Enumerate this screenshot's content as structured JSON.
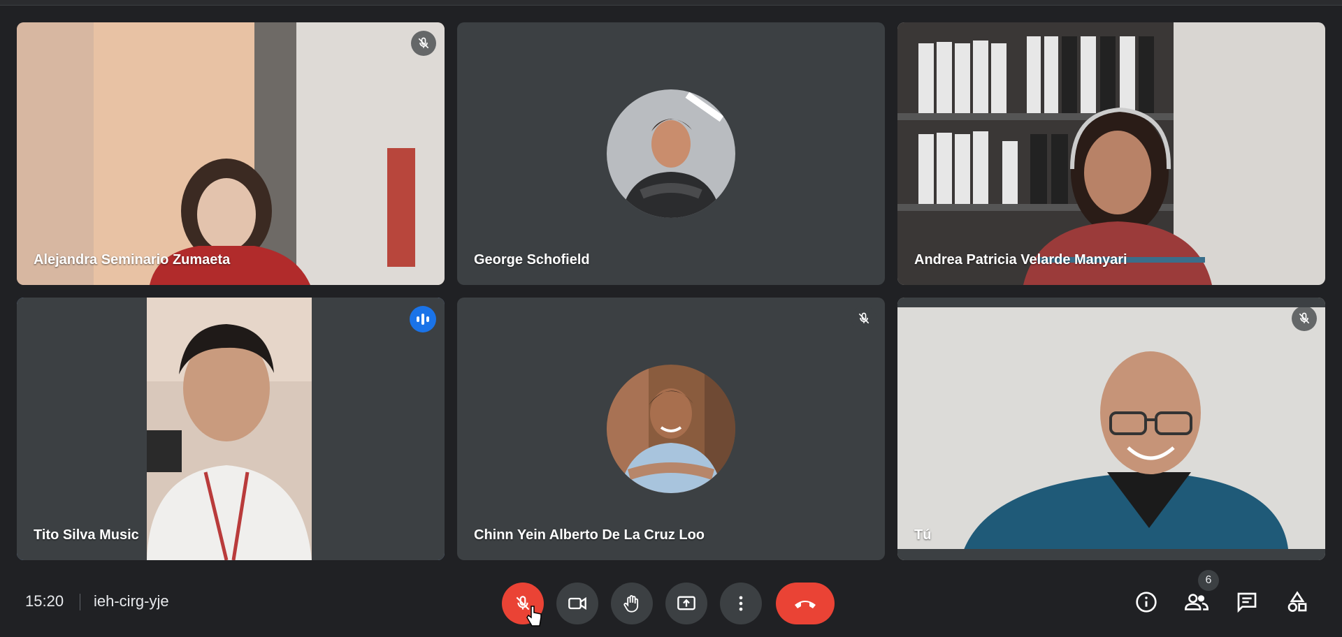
{
  "participants": [
    {
      "name": "Alejandra Seminario Zumaeta",
      "muted": true
    },
    {
      "name": "George Schofield",
      "muted": false
    },
    {
      "name": "Andrea Patricia Velarde Manyari",
      "muted": false
    },
    {
      "name": "Tito Silva Music",
      "speaking": true
    },
    {
      "name": "Chinn Yein Alberto De La Cruz Loo",
      "muted": true
    },
    {
      "name": "Tú",
      "muted": true
    }
  ],
  "meeting": {
    "time": "15:20",
    "code": "ieh-cirg-yje"
  },
  "controls": [
    "mic-off-icon",
    "camera-icon",
    "raise-hand-icon",
    "present-screen-icon",
    "more-options-icon",
    "end-call-icon"
  ],
  "side": {
    "people_count": "6"
  },
  "colors": {
    "accent": "#1a73e8",
    "danger": "#ea4335",
    "background": "#202124",
    "tile": "#3c4043"
  }
}
